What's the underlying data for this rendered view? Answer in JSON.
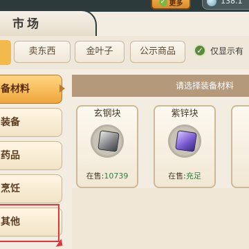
{
  "header": {
    "title": "市场",
    "gold_button_label": "更多",
    "currency_value": "138.1"
  },
  "subtabs": [
    {
      "label": "卖东西"
    },
    {
      "label": "金叶子"
    },
    {
      "label": "公示商品"
    }
  ],
  "filter": {
    "checkbox_label": "仅显示有",
    "checked": true
  },
  "categories": [
    {
      "label": "备材料",
      "active": true
    },
    {
      "label": "装备",
      "active": false
    },
    {
      "label": "药品",
      "active": false
    },
    {
      "label": "烹饪",
      "active": false
    },
    {
      "label": "其他",
      "active": false
    }
  ],
  "hint": "请选择装备材料",
  "items": [
    {
      "name": "玄钢块",
      "sale_label": "在售:",
      "sale_value": "10739"
    },
    {
      "name": "紫锌块",
      "sale_label": "在售:",
      "sale_value": "充足"
    }
  ],
  "colors": {
    "accent_orange": "#f0a53a",
    "highlight_red": "#e0353a",
    "sale_green": "#2f7d3a"
  }
}
